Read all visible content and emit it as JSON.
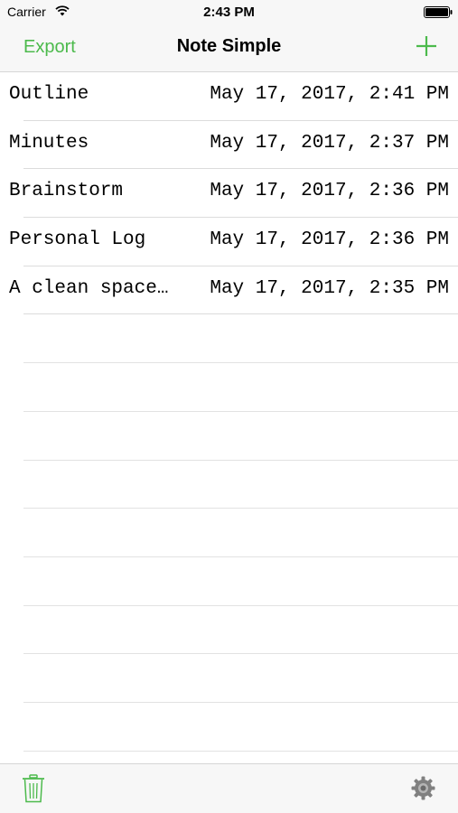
{
  "status_bar": {
    "carrier": "Carrier",
    "time": "2:43 PM",
    "icons": [
      "wifi-icon",
      "battery-icon"
    ]
  },
  "nav": {
    "left_button": "Export",
    "title": "Note Simple",
    "right_icon": "plus-icon"
  },
  "notes": [
    {
      "title": "Outline",
      "date": "May 17, 2017, 2:41 PM"
    },
    {
      "title": "Minutes",
      "date": "May 17, 2017, 2:37 PM"
    },
    {
      "title": "Brainstorm",
      "date": "May 17, 2017, 2:36 PM"
    },
    {
      "title": "Personal Log",
      "date": "May 17, 2017, 2:36 PM"
    },
    {
      "title": "A clean space…",
      "date": "May 17, 2017, 2:35 PM"
    }
  ],
  "toolbar": {
    "left_icon": "trash-icon",
    "right_icon": "gear-icon"
  },
  "colors": {
    "accent": "#4cba4c",
    "bar_background": "#f7f7f7",
    "separator": "#dcdcdc"
  }
}
